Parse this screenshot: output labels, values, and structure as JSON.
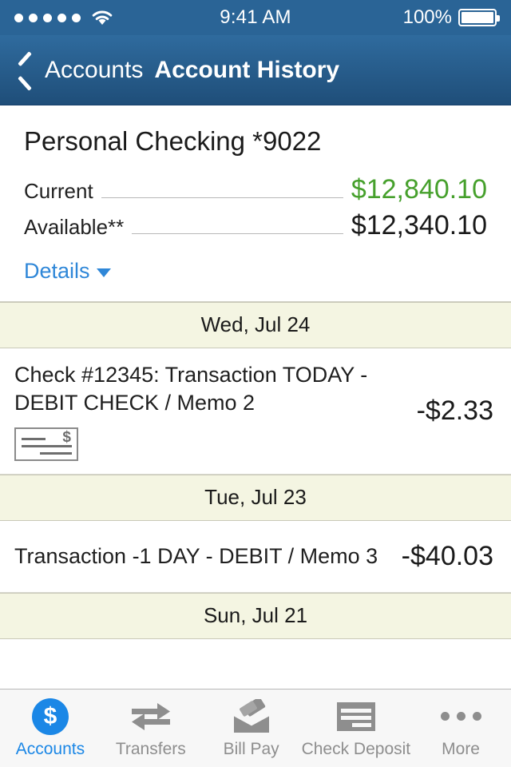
{
  "status_bar": {
    "signal_dots": 5,
    "wifi_icon": "wifi-icon",
    "time": "9:41 AM",
    "battery_percent": "100%",
    "battery_icon": "battery-full-icon"
  },
  "nav_bar": {
    "back_icon": "chevron-left-icon",
    "back_label": "Accounts",
    "title": "Account History"
  },
  "account_summary": {
    "account_name": "Personal Checking *9022",
    "balances": [
      {
        "label": "Current",
        "value": "$12,840.10",
        "color": "#46a02c"
      },
      {
        "label": "Available**",
        "value": "$12,340.10",
        "color": "#1a1a1a"
      }
    ],
    "details_label": "Details",
    "details_caret_icon": "caret-down-icon",
    "details_color": "#2f87d8"
  },
  "transactions": {
    "groups": [
      {
        "date": "Wed, Jul 24",
        "rows": [
          {
            "description": "Check #12345: Transaction TODAY - DEBIT CHECK / Memo 2",
            "amount": "-$2.33",
            "has_check_image": true,
            "check_icon": "check-image-icon"
          }
        ]
      },
      {
        "date": "Tue, Jul 23",
        "rows": [
          {
            "description": "Transaction -1 DAY - DEBIT / Memo 3",
            "amount": "-$40.03",
            "has_check_image": false
          }
        ]
      },
      {
        "date": "Sun, Jul 21",
        "rows": []
      }
    ]
  },
  "tab_bar": {
    "active_index": 0,
    "active_color": "#1b87e6",
    "inactive_color": "#8e8e8e",
    "items": [
      {
        "label": "Accounts",
        "icon": "dollar-circle-icon"
      },
      {
        "label": "Transfers",
        "icon": "transfer-arrows-icon"
      },
      {
        "label": "Bill Pay",
        "icon": "envelope-icon"
      },
      {
        "label": "Check Deposit",
        "icon": "check-deposit-icon"
      },
      {
        "label": "More",
        "icon": "ellipsis-icon"
      }
    ]
  }
}
